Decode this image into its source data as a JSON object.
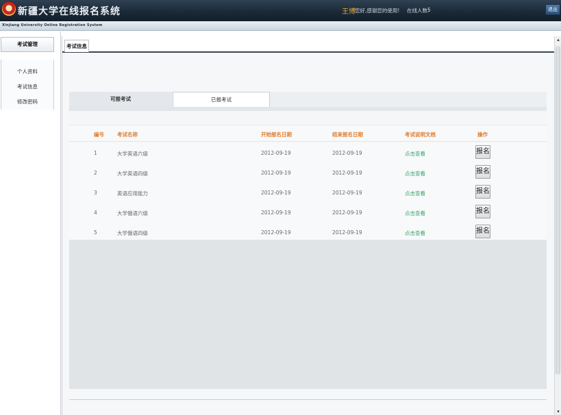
{
  "header": {
    "title": "新疆大学在线报名系统",
    "subtitle": "Xinjiang University Online Registration System",
    "user_name": "王博",
    "greeting": "您好,感谢您的使用!",
    "online_label": "在线人数:",
    "online_count": "5",
    "logout_label": "退出"
  },
  "sidebar": {
    "header": "考试管理",
    "items": [
      {
        "label": "个人资料"
      },
      {
        "label": "考试信息"
      },
      {
        "label": "修改密码"
      }
    ]
  },
  "main": {
    "tab": "考试信息",
    "subtabs": {
      "available": "可报考试",
      "registered": "已报考试"
    },
    "table": {
      "headers": [
        "编号",
        "考试名称",
        "开始报名日期",
        "结束报名日期",
        "考试说明文档",
        "操作"
      ],
      "rows": [
        {
          "id": "1",
          "name": "大学英语六级",
          "start": "2012-09-19",
          "end": "2012-09-19",
          "doc": "点击查看",
          "action": "报名"
        },
        {
          "id": "2",
          "name": "大学英语四级",
          "start": "2012-09-19",
          "end": "2012-09-19",
          "doc": "点击查看",
          "action": "报名"
        },
        {
          "id": "3",
          "name": "英语应用能力",
          "start": "2012-09-19",
          "end": "2012-09-19",
          "doc": "点击查看",
          "action": "报名"
        },
        {
          "id": "4",
          "name": "大学俄语六级",
          "start": "2012-09-19",
          "end": "2012-09-19",
          "doc": "点击查看",
          "action": "报名"
        },
        {
          "id": "5",
          "name": "大学俄语四级",
          "start": "2012-09-19",
          "end": "2012-09-19",
          "doc": "点击查看",
          "action": "报名"
        }
      ]
    }
  },
  "scrollbar": {
    "up": "▴",
    "down": "▾"
  },
  "colors": {
    "header_orange": "#e07d2d",
    "link_green": "#3aa36b",
    "top_bar": "#1b2a38"
  }
}
